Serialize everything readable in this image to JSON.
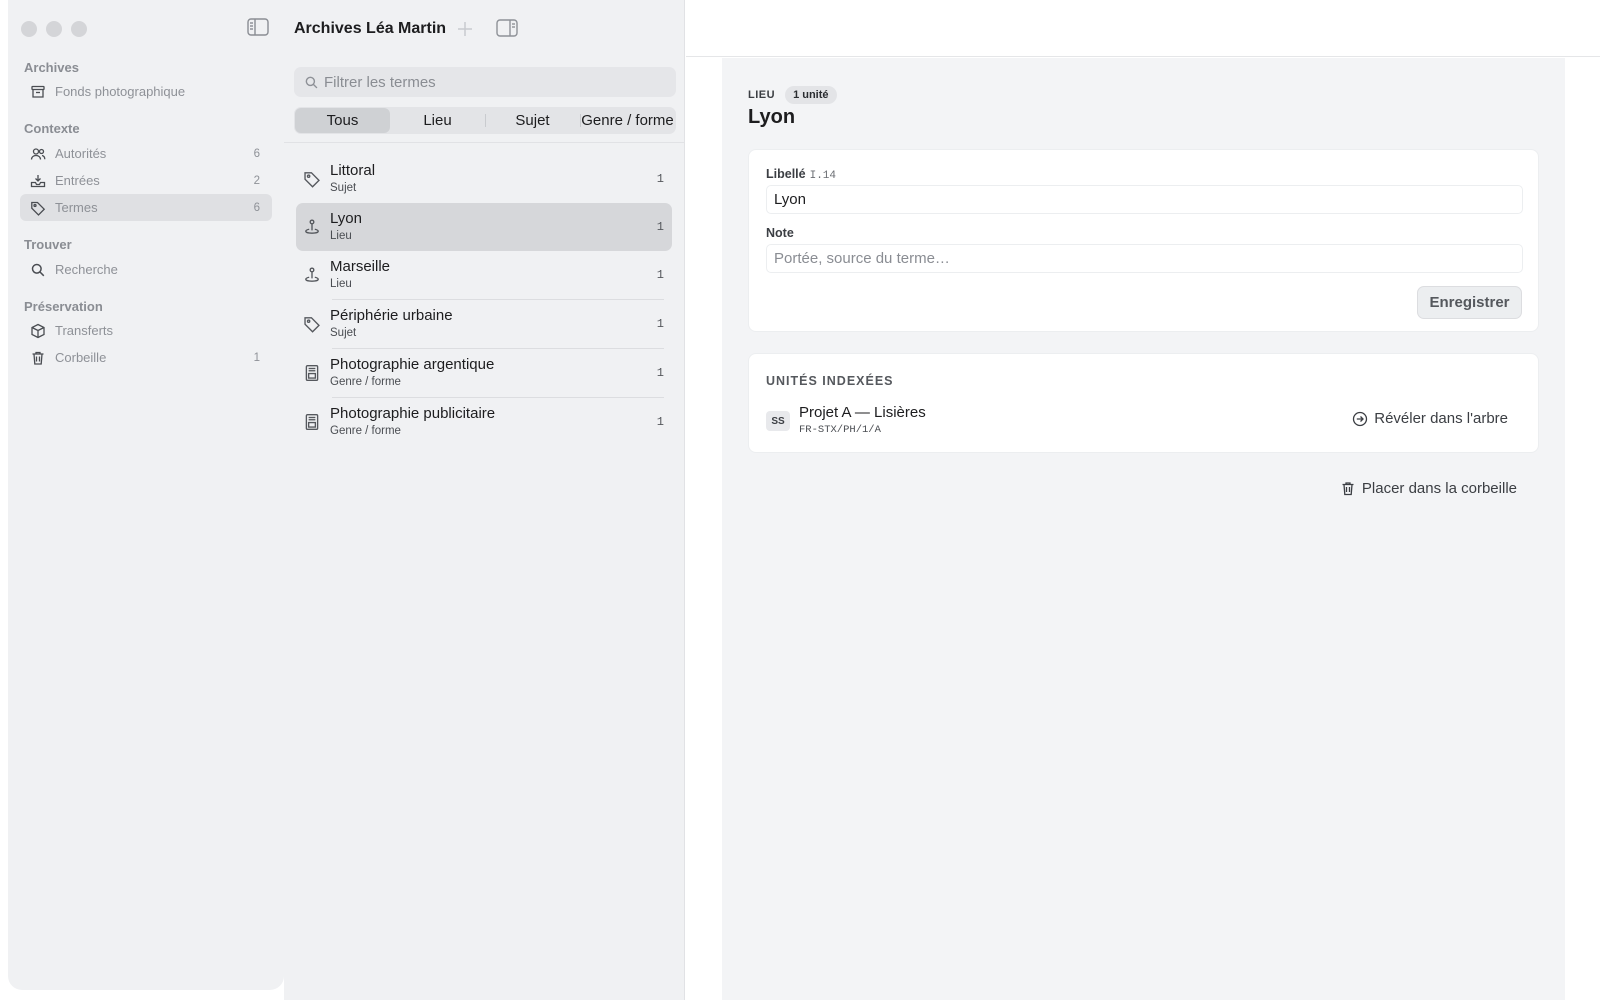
{
  "sidebar": {
    "sections": [
      {
        "title": "Archives",
        "items": [
          {
            "label": "Fonds photographique",
            "icon": "archive-box-icon",
            "count": ""
          }
        ]
      },
      {
        "title": "Contexte",
        "items": [
          {
            "label": "Autorités",
            "icon": "people-icon",
            "count": "6"
          },
          {
            "label": "Entrées",
            "icon": "inbox-tray-icon",
            "count": "2"
          },
          {
            "label": "Termes",
            "icon": "tag-icon",
            "count": "6",
            "active": true
          }
        ]
      },
      {
        "title": "Trouver",
        "items": [
          {
            "label": "Recherche",
            "icon": "search-icon",
            "count": ""
          }
        ]
      },
      {
        "title": "Préservation",
        "items": [
          {
            "label": "Transferts",
            "icon": "package-icon",
            "count": ""
          },
          {
            "label": "Corbeille",
            "icon": "trash-icon",
            "count": "1"
          }
        ]
      }
    ]
  },
  "list_panel": {
    "title": "Archives Léa Martin",
    "search_placeholder": "Filtrer les termes",
    "filters": [
      "Tous",
      "Lieu",
      "Sujet",
      "Genre / forme"
    ],
    "active_filter": "Tous",
    "terms": [
      {
        "name": "Littoral",
        "type": "Sujet",
        "count": "1",
        "icon": "tag-icon"
      },
      {
        "name": "Lyon",
        "type": "Lieu",
        "count": "1",
        "icon": "map-pin-icon",
        "active": true
      },
      {
        "name": "Marseille",
        "type": "Lieu",
        "count": "1",
        "icon": "map-pin-icon"
      },
      {
        "name": "Périphérie urbaine",
        "type": "Sujet",
        "count": "1",
        "icon": "tag-icon"
      },
      {
        "name": "Photographie argentique",
        "type": "Genre / forme",
        "count": "1",
        "icon": "document-image-icon"
      },
      {
        "name": "Photographie publicitaire",
        "type": "Genre / forme",
        "count": "1",
        "icon": "document-image-icon"
      }
    ]
  },
  "detail": {
    "kind": "LIEU",
    "units_pill": "1 unité",
    "title": "Lyon",
    "label_field": {
      "label": "Libellé",
      "code": "I.14",
      "value": "Lyon"
    },
    "note_field": {
      "label": "Note",
      "placeholder": "Portée, source du terme…",
      "value": ""
    },
    "save_label": "Enregistrer",
    "indexed_header": "UNITÉS INDEXÉES",
    "indexed_units": [
      {
        "badge": "SS",
        "name": "Projet A — Lisières",
        "code": "FR-STX/PH/1/A",
        "action": "Révéler dans l'arbre"
      }
    ],
    "trash_label": "Placer dans la corbeille"
  }
}
